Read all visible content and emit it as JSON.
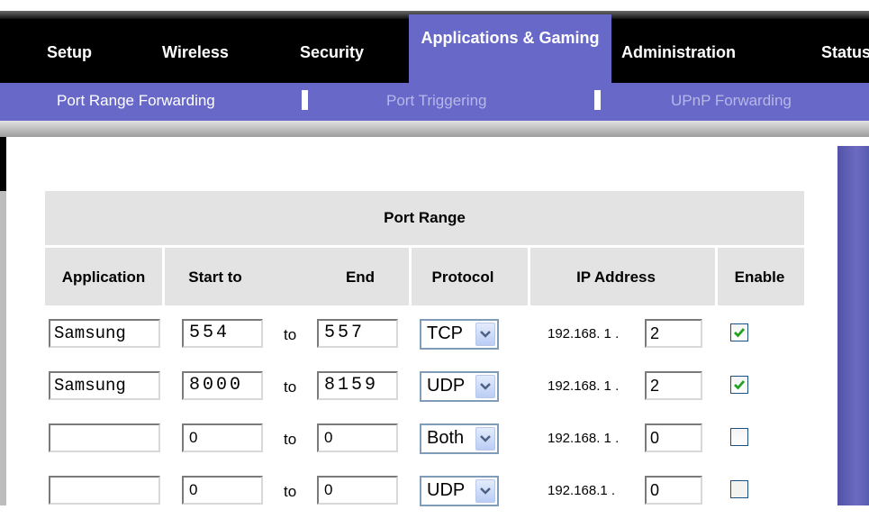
{
  "nav": {
    "tabs": [
      {
        "label": "Setup"
      },
      {
        "label": "Wireless"
      },
      {
        "label": "Security"
      },
      {
        "label": "Applications & Gaming"
      },
      {
        "label": "Administration"
      },
      {
        "label": "Status"
      }
    ],
    "active_tab": "Applications & Gaming",
    "subtabs": [
      {
        "label": "Port Range Forwarding"
      },
      {
        "label": "Port Triggering"
      },
      {
        "label": "UPnP Forwarding"
      }
    ],
    "active_subtab": "Port Range Forwarding"
  },
  "table": {
    "group_header": "Port Range",
    "columns": {
      "application": "Application",
      "start": "Start to",
      "end": "End",
      "protocol": "Protocol",
      "ip_address": "IP Address",
      "enable": "Enable"
    },
    "to_label": "to",
    "ip_prefix_values": [
      "192.168. 1 .",
      "192.168. 1 .",
      "192.168. 1 .",
      "192.168.1 ."
    ],
    "rows": [
      {
        "application": "Samsung",
        "start": "554",
        "end": "557",
        "protocol": "TCP",
        "ip_last": "2",
        "enabled": true
      },
      {
        "application": "Samsung",
        "start": "8000",
        "end": "8159",
        "protocol": "UDP",
        "ip_last": "2",
        "enabled": true
      },
      {
        "application": "",
        "start": "0",
        "end": "0",
        "protocol": "Both",
        "ip_last": "0",
        "enabled": false
      },
      {
        "application": "",
        "start": "0",
        "end": "0",
        "protocol": "UDP",
        "ip_last": "0",
        "enabled": false
      }
    ]
  },
  "colors": {
    "accent": "#6868c8",
    "nav_bg": "#000000",
    "header_bg": "#e3e3e3",
    "check": "#21a121"
  },
  "icons": {
    "dropdown": "chevron-down-icon",
    "checkbox_checked": "checkmark-icon"
  }
}
